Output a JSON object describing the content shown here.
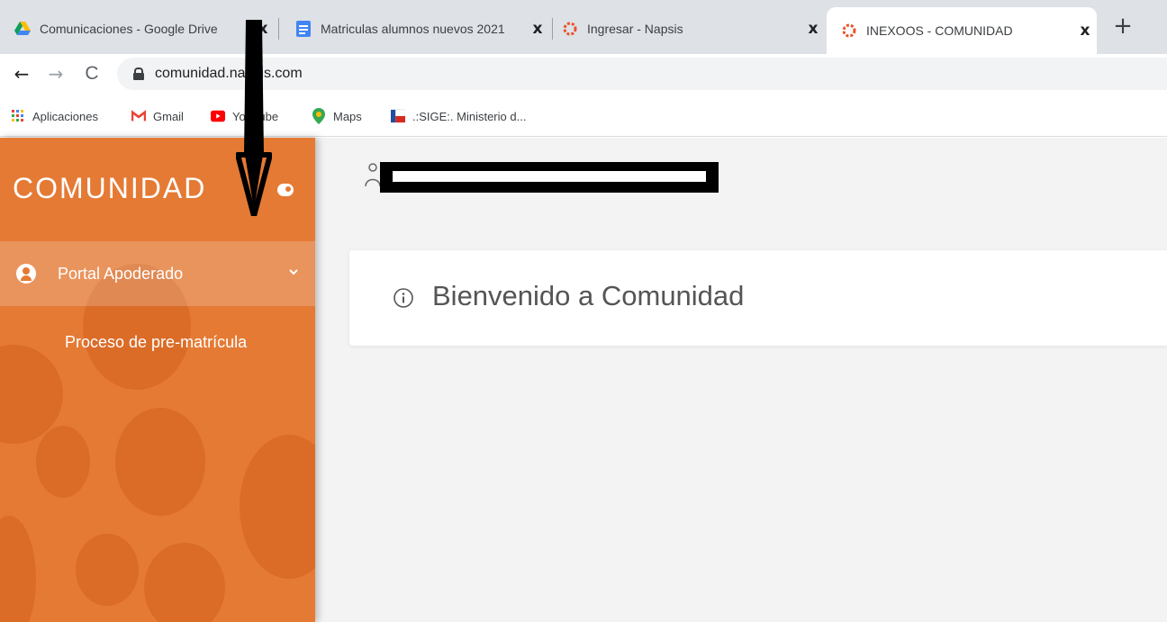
{
  "browser": {
    "tabs": [
      {
        "title": "Comunicaciones - Google Drive",
        "close": "x",
        "favicon": "google-drive-icon"
      },
      {
        "title": "Matriculas alumnos nuevos 2021",
        "close": "x",
        "favicon": "google-docs-icon"
      },
      {
        "title": "Ingresar - Napsis",
        "close": "x",
        "favicon": "napsis-icon"
      },
      {
        "title": "INEXOOS - COMUNIDAD",
        "close": "x",
        "favicon": "napsis-icon",
        "active": true
      }
    ],
    "new_tab": "+",
    "nav": {
      "back": "←",
      "forward": "→",
      "reload": "C"
    },
    "url": "comunidad.napsis.com",
    "bookmarks": [
      {
        "label": "Aplicaciones",
        "icon": "apps-grid-icon"
      },
      {
        "label": "Gmail",
        "icon": "gmail-icon"
      },
      {
        "label": "YouTube",
        "icon": "youtube-icon"
      },
      {
        "label": "Maps",
        "icon": "maps-pin-icon"
      },
      {
        "label": ".:SIGE:. Ministerio d...",
        "icon": "chile-flag-icon"
      }
    ]
  },
  "sidebar": {
    "brand": "COMUNIDAD",
    "menu": [
      {
        "label": "Portal Apoderado",
        "expanded": true,
        "children": [
          {
            "label": "Proceso de pre-matrícula"
          }
        ]
      }
    ]
  },
  "main": {
    "card_title": "Bienvenido a Comunidad"
  },
  "colors": {
    "sidebar": "#e57a35",
    "main_bg": "#f3f3f3",
    "tabstrip": "#dee1e6"
  }
}
